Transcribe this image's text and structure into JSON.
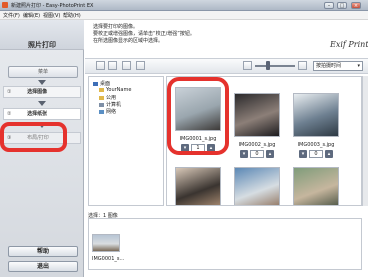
{
  "window": {
    "title": "新建照片打印 - Easy-PhotoPrint EX",
    "minimize_glyph": "–",
    "maximize_glyph": "□",
    "close_glyph": "×"
  },
  "menu": [
    "文件(F)",
    "编辑(E)",
    "视图(V)",
    "帮助(H)"
  ],
  "left_panel": {
    "title": "照片打印",
    "menu_button": "菜单",
    "steps": [
      {
        "num": "①",
        "label": "选择图像"
      },
      {
        "num": "②",
        "label": "选择纸张"
      },
      {
        "num": "③",
        "label": "布局/打印"
      }
    ],
    "help_button": "帮助",
    "exit_button": "退出"
  },
  "content": {
    "instructions": [
      "选择要打印的图像。",
      "要校正或增强图像，请单击“校正/增强”按钮。",
      "在所选图像显示的区域中选择。"
    ],
    "logo": "Exif Print",
    "sort_label": "按拍摄时间"
  },
  "tree": [
    {
      "label": "桌面",
      "level": 0
    },
    {
      "label": "YourName",
      "level": 1
    },
    {
      "label": "公用",
      "level": 1
    },
    {
      "label": "计算机",
      "level": 1
    },
    {
      "label": "网络",
      "level": 1
    }
  ],
  "thumbnails": [
    {
      "name": "IMG0001_s.jpg",
      "copies": "1",
      "colors": [
        "#c9d1d8",
        "#9aa6ae",
        "#3d3a38"
      ]
    },
    {
      "name": "IMG0002_s.jpg",
      "copies": "0",
      "colors": [
        "#2b2a2c",
        "#8c7f78",
        "#1d1c1f"
      ]
    },
    {
      "name": "IMG0003_s.jpg",
      "copies": "0",
      "colors": [
        "#e9eef1",
        "#6e8091",
        "#2e3a44"
      ]
    },
    {
      "name": "",
      "copies": "",
      "colors": [
        "#d8c8b8",
        "#3a3430",
        "#b49478"
      ]
    },
    {
      "name": "",
      "copies": "",
      "colors": [
        "#5b88b5",
        "#d6dde2",
        "#8a6a52"
      ]
    },
    {
      "name": "",
      "copies": "",
      "colors": [
        "#7f9c7a",
        "#c6b69e",
        "#3e4a3a"
      ]
    }
  ],
  "tray": {
    "label": "选择：1 图像",
    "item_name": "IMG0001_s..."
  },
  "colors": {
    "highlight": "#e5322d"
  }
}
